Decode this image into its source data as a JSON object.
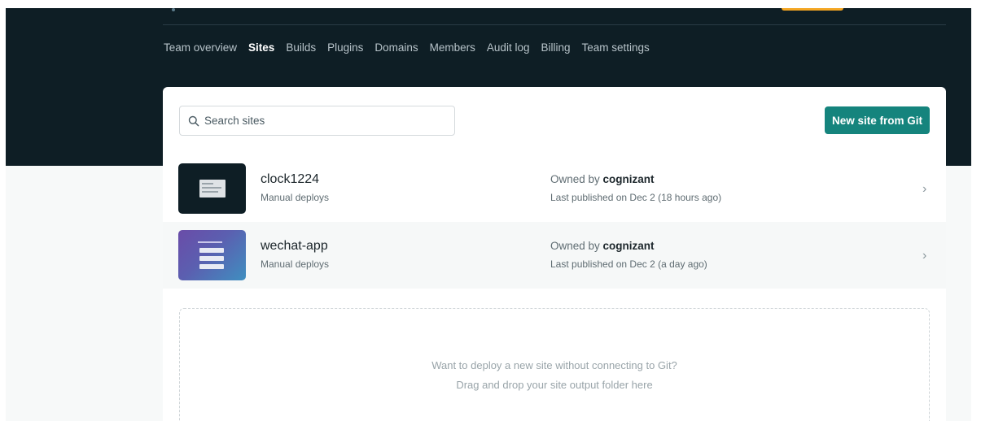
{
  "nav": {
    "items": [
      {
        "label": "Team overview",
        "active": false
      },
      {
        "label": "Sites",
        "active": true
      },
      {
        "label": "Builds",
        "active": false
      },
      {
        "label": "Plugins",
        "active": false
      },
      {
        "label": "Domains",
        "active": false
      },
      {
        "label": "Members",
        "active": false
      },
      {
        "label": "Audit log",
        "active": false
      },
      {
        "label": "Billing",
        "active": false
      },
      {
        "label": "Team settings",
        "active": false
      }
    ]
  },
  "search": {
    "placeholder": "Search sites",
    "icon": "search-icon"
  },
  "new_site_button": "New site from Git",
  "sites": [
    {
      "name": "clock1224",
      "deploy_type": "Manual deploys",
      "owned_prefix": "Owned by ",
      "owner": "cognizant",
      "last_published": "Last published on Dec 2 (18 hours ago)"
    },
    {
      "name": "wechat-app",
      "deploy_type": "Manual deploys",
      "owned_prefix": "Owned by ",
      "owner": "cognizant",
      "last_published": "Last published on Dec 2 (a day ago)"
    }
  ],
  "dropzone": {
    "line1": "Want to deploy a new site without connecting to Git?",
    "line2": "Drag and drop your site output folder here"
  },
  "colors": {
    "header_bg": "#0e1e25",
    "primary_button": "#15847d",
    "accent": "#f4a623"
  }
}
